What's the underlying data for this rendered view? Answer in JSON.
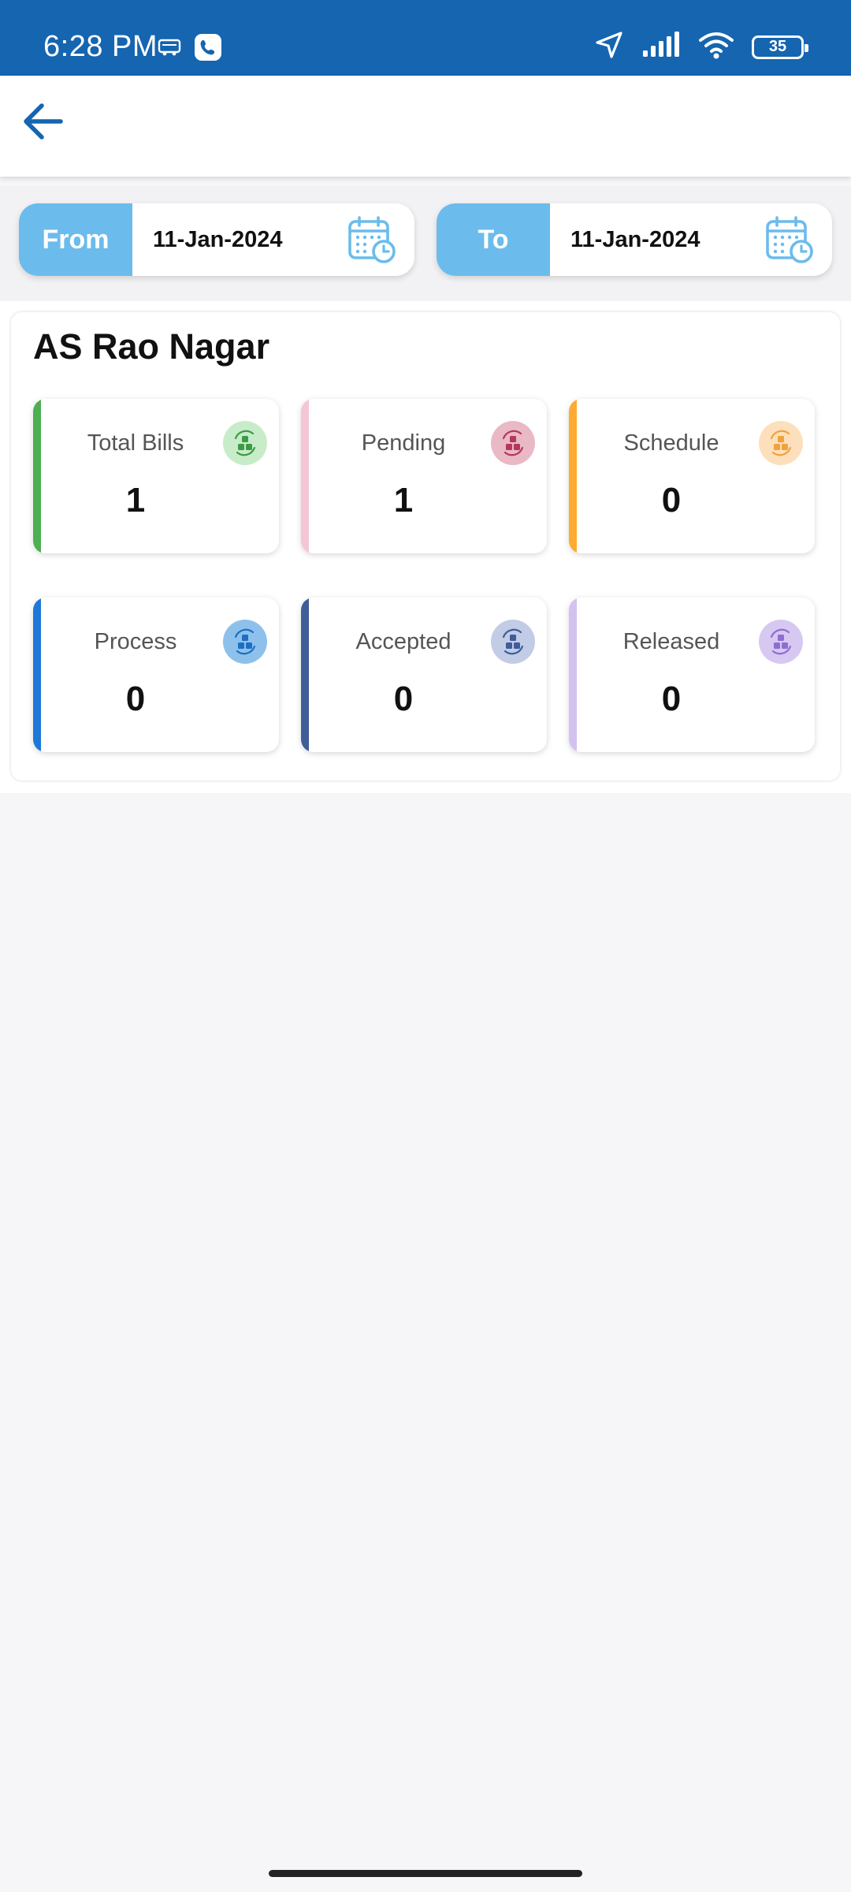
{
  "status_bar": {
    "time": "6:28 PM",
    "battery": "35",
    "icons": [
      "redbus-icon",
      "phone-call-icon",
      "location-arrow-icon",
      "signal-icon",
      "wifi-icon",
      "battery-icon"
    ]
  },
  "header": {
    "back_icon": "arrow-left-icon"
  },
  "date_filter": {
    "from_label": "From",
    "from_value": "11-Jan-2024",
    "to_label": "To",
    "to_value": "11-Jan-2024",
    "calendar_icon": "calendar-clock-icon"
  },
  "location": {
    "title": "AS Rao Nagar"
  },
  "stats": [
    {
      "label": "Total Bills",
      "value": "1",
      "accent": "#4caf50",
      "icon_bg": "#c8ecc9",
      "icon_color": "#3d9a45"
    },
    {
      "label": "Pending",
      "value": "1",
      "accent": "#f4c6d3",
      "icon_bg": "#eab9c6",
      "icon_color": "#b3385c"
    },
    {
      "label": "Schedule",
      "value": "0",
      "accent": "#ffaa30",
      "icon_bg": "#fde0bb",
      "icon_color": "#f2a23a"
    },
    {
      "label": "Process",
      "value": "0",
      "accent": "#1e78d8",
      "icon_bg": "#8dc1ec",
      "icon_color": "#1e6fc2"
    },
    {
      "label": "Accepted",
      "value": "0",
      "accent": "#3f5d98",
      "icon_bg": "#c2cce6",
      "icon_color": "#3f5d98"
    },
    {
      "label": "Released",
      "value": "0",
      "accent": "#d3c2f0",
      "icon_bg": "#d7c8f2",
      "icon_color": "#8e6fd0"
    }
  ]
}
